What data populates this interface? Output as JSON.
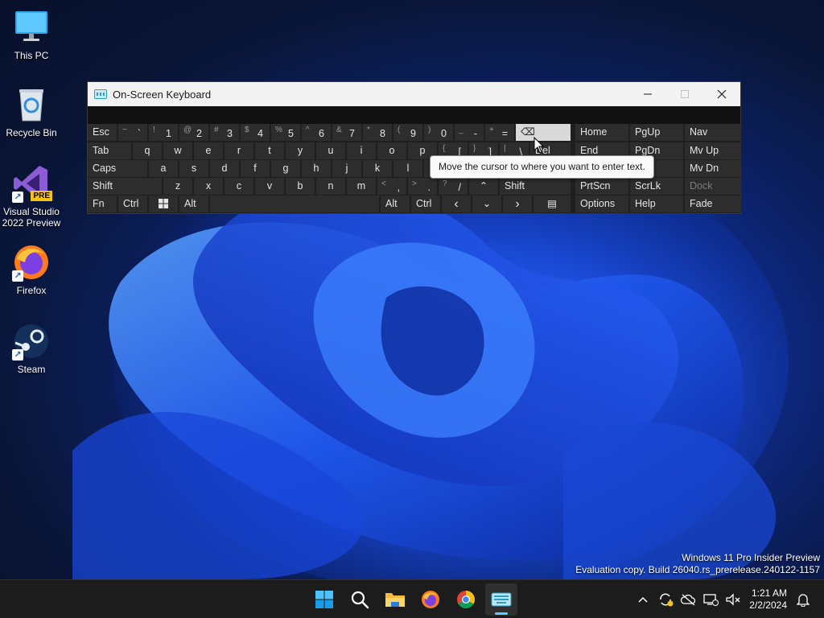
{
  "desktop": {
    "icons": [
      {
        "label": "This PC",
        "icon": "monitor-icon"
      },
      {
        "label": "Recycle Bin",
        "icon": "recycle-bin-icon"
      },
      {
        "label": "Visual Studio 2022 Preview",
        "icon": "visual-studio-icon",
        "badge": "PRE"
      },
      {
        "label": "Firefox",
        "icon": "firefox-icon"
      },
      {
        "label": "Steam",
        "icon": "steam-icon"
      }
    ]
  },
  "osk": {
    "title": "On-Screen Keyboard",
    "rows": {
      "r1": [
        {
          "id": "esc",
          "label": "Esc"
        },
        {
          "id": "tilde",
          "shift": "~",
          "main": "`"
        },
        {
          "id": "1",
          "shift": "!",
          "main": "1"
        },
        {
          "id": "2",
          "shift": "@",
          "main": "2"
        },
        {
          "id": "3",
          "shift": "#",
          "main": "3"
        },
        {
          "id": "4",
          "shift": "$",
          "main": "4"
        },
        {
          "id": "5",
          "shift": "%",
          "main": "5"
        },
        {
          "id": "6",
          "shift": "^",
          "main": "6"
        },
        {
          "id": "7",
          "shift": "&",
          "main": "7"
        },
        {
          "id": "8",
          "shift": "*",
          "main": "8"
        },
        {
          "id": "9",
          "shift": "(",
          "main": "9"
        },
        {
          "id": "0",
          "shift": ")",
          "main": "0"
        },
        {
          "id": "minus",
          "shift": "_",
          "main": "-"
        },
        {
          "id": "equals",
          "shift": "+",
          "main": "="
        },
        {
          "id": "backspace",
          "label": "⌫"
        },
        {
          "id": "home",
          "label": "Home"
        },
        {
          "id": "pgup",
          "label": "PgUp"
        },
        {
          "id": "nav",
          "label": "Nav"
        }
      ],
      "r2": [
        {
          "id": "tab",
          "label": "Tab"
        },
        {
          "id": "q",
          "label": "q"
        },
        {
          "id": "w",
          "label": "w"
        },
        {
          "id": "e",
          "label": "e"
        },
        {
          "id": "r",
          "label": "r"
        },
        {
          "id": "t",
          "label": "t"
        },
        {
          "id": "y",
          "label": "y"
        },
        {
          "id": "u",
          "label": "u"
        },
        {
          "id": "i",
          "label": "i"
        },
        {
          "id": "o",
          "label": "o"
        },
        {
          "id": "p",
          "label": "p"
        },
        {
          "id": "lbracket",
          "shift": "{",
          "main": "["
        },
        {
          "id": "rbracket",
          "shift": "}",
          "main": "]"
        },
        {
          "id": "backslash",
          "shift": "|",
          "main": "\\"
        },
        {
          "id": "del",
          "label": "Del"
        },
        {
          "id": "end",
          "label": "End"
        },
        {
          "id": "pgdn",
          "label": "PgDn"
        },
        {
          "id": "mvup",
          "label": "Mv Up"
        }
      ],
      "r3": [
        {
          "id": "caps",
          "label": "Caps"
        },
        {
          "id": "a",
          "label": "a"
        },
        {
          "id": "s",
          "label": "s"
        },
        {
          "id": "d",
          "label": "d"
        },
        {
          "id": "f",
          "label": "f"
        },
        {
          "id": "g",
          "label": "g"
        },
        {
          "id": "h",
          "label": "h"
        },
        {
          "id": "j",
          "label": "j"
        },
        {
          "id": "k",
          "label": "k"
        },
        {
          "id": "l",
          "label": "l"
        },
        {
          "id": "mvdn",
          "label": "Mv Dn"
        }
      ],
      "r4": [
        {
          "id": "lshift",
          "label": "Shift"
        },
        {
          "id": "z",
          "label": "z"
        },
        {
          "id": "x",
          "label": "x"
        },
        {
          "id": "c",
          "label": "c"
        },
        {
          "id": "v",
          "label": "v"
        },
        {
          "id": "b",
          "label": "b"
        },
        {
          "id": "n",
          "label": "n"
        },
        {
          "id": "m",
          "label": "m"
        },
        {
          "id": "comma",
          "shift": "<",
          "main": ","
        },
        {
          "id": "period",
          "shift": ">",
          "main": "."
        },
        {
          "id": "slash",
          "shift": "?",
          "main": "/"
        },
        {
          "id": "up",
          "label": "⌃"
        },
        {
          "id": "rshift",
          "label": "Shift"
        },
        {
          "id": "prtscn",
          "label": "PrtScn"
        },
        {
          "id": "scrlk",
          "label": "ScrLk"
        },
        {
          "id": "dock",
          "label": "Dock"
        }
      ],
      "r5": [
        {
          "id": "fn",
          "label": "Fn"
        },
        {
          "id": "lctrl",
          "label": "Ctrl"
        },
        {
          "id": "win",
          "label": ""
        },
        {
          "id": "lalt",
          "label": "Alt"
        },
        {
          "id": "space",
          "label": ""
        },
        {
          "id": "ralt",
          "label": "Alt"
        },
        {
          "id": "rctrl",
          "label": "Ctrl"
        },
        {
          "id": "left",
          "label": "‹"
        },
        {
          "id": "down",
          "label": "⌄"
        },
        {
          "id": "right",
          "label": "›"
        },
        {
          "id": "menu",
          "label": "▤"
        },
        {
          "id": "options",
          "label": "Options"
        },
        {
          "id": "help",
          "label": "Help"
        },
        {
          "id": "fade",
          "label": "Fade"
        }
      ]
    },
    "tooltip": "Move the cursor to where you want to enter text."
  },
  "watermark": {
    "line1": "Windows 11 Pro Insider Preview",
    "line2": "Evaluation copy. Build 26040.rs_prerelease.240122-1157"
  },
  "taskbar": {
    "apps": [
      "start-icon",
      "search-icon",
      "file-explorer-icon",
      "firefox-icon",
      "chrome-icon",
      "on-screen-keyboard-icon"
    ],
    "time": "1:21 AM",
    "date": "2/2/2024"
  },
  "colors": {
    "accent": "#60cdff",
    "key_bg": "#2d2d2d",
    "key_active": "#d9d9d9",
    "taskbar": "#1c1c1c"
  }
}
